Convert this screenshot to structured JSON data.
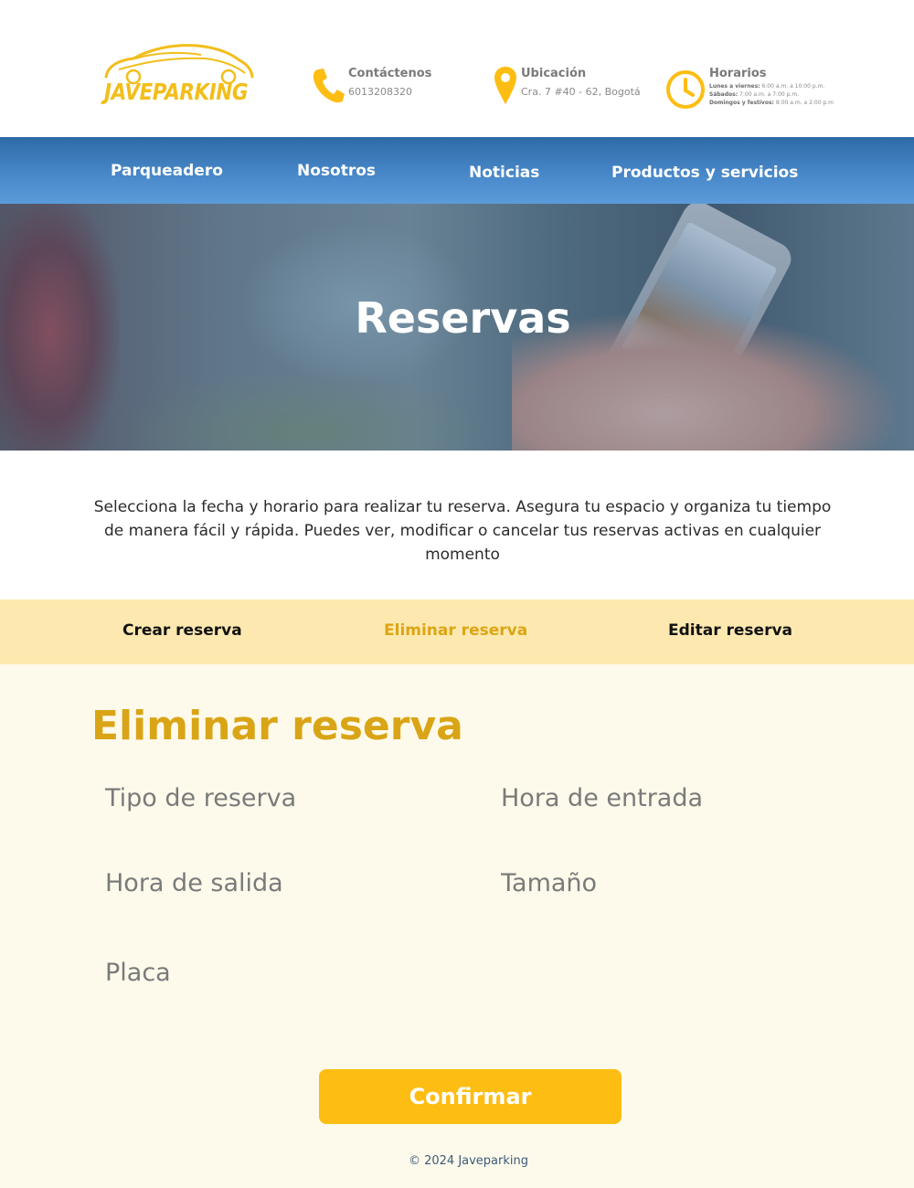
{
  "header": {
    "logo_text": "JAVEPARKING",
    "contact": {
      "title": "Contáctenos",
      "value": "6013208320"
    },
    "location": {
      "title": "Ubicación",
      "value": "Cra. 7 #40 - 62, Bogotá"
    },
    "hours": {
      "title": "Horarios",
      "lines": [
        {
          "label": "Lunes a viernes:",
          "value": "6:00 a.m. a 10:00 p.m."
        },
        {
          "label": "Sábados:",
          "value": "7:00 a.m. a 7:00 p.m."
        },
        {
          "label": "Domingos y festivos:",
          "value": "8:00 a.m. a 2:00 p.m"
        }
      ]
    }
  },
  "nav": {
    "items": [
      {
        "label": "Parqueadero"
      },
      {
        "label": "Nosotros"
      },
      {
        "label": "Noticias"
      },
      {
        "label": "Productos y servicios"
      }
    ]
  },
  "hero": {
    "title": "Reservas"
  },
  "intro": {
    "text": "Selecciona la fecha y horario para realizar tu reserva. Asegura tu espacio y organiza tu tiempo de manera fácil y rápida. Puedes ver, modificar o cancelar tus reservas activas en cualquier momento"
  },
  "tabs": {
    "items": [
      {
        "label": "Crear reserva"
      },
      {
        "label": "Eliminar reserva",
        "active": true
      },
      {
        "label": "Editar reserva"
      }
    ]
  },
  "form": {
    "title": "Eliminar reserva",
    "fields": {
      "tipo": {
        "placeholder": "Tipo de reserva",
        "value": ""
      },
      "entrada": {
        "placeholder": "Hora de entrada",
        "value": ""
      },
      "salida": {
        "placeholder": "Hora de salida",
        "value": ""
      },
      "tamano": {
        "placeholder": "Tamaño",
        "value": ""
      },
      "placa": {
        "placeholder": "Placa",
        "value": ""
      }
    },
    "confirm_label": "Confirmar"
  },
  "footer": {
    "text": "© 2024 Javeparking"
  },
  "colors": {
    "accent": "#fdbd12",
    "accent_text": "#d9a516",
    "nav_blue": "#4a8acb",
    "tabs_bg": "#fde9b0",
    "form_bg": "#fefaeb"
  },
  "icons": {
    "contact": "phone-icon",
    "location": "map-pin-icon",
    "hours": "clock-icon"
  }
}
